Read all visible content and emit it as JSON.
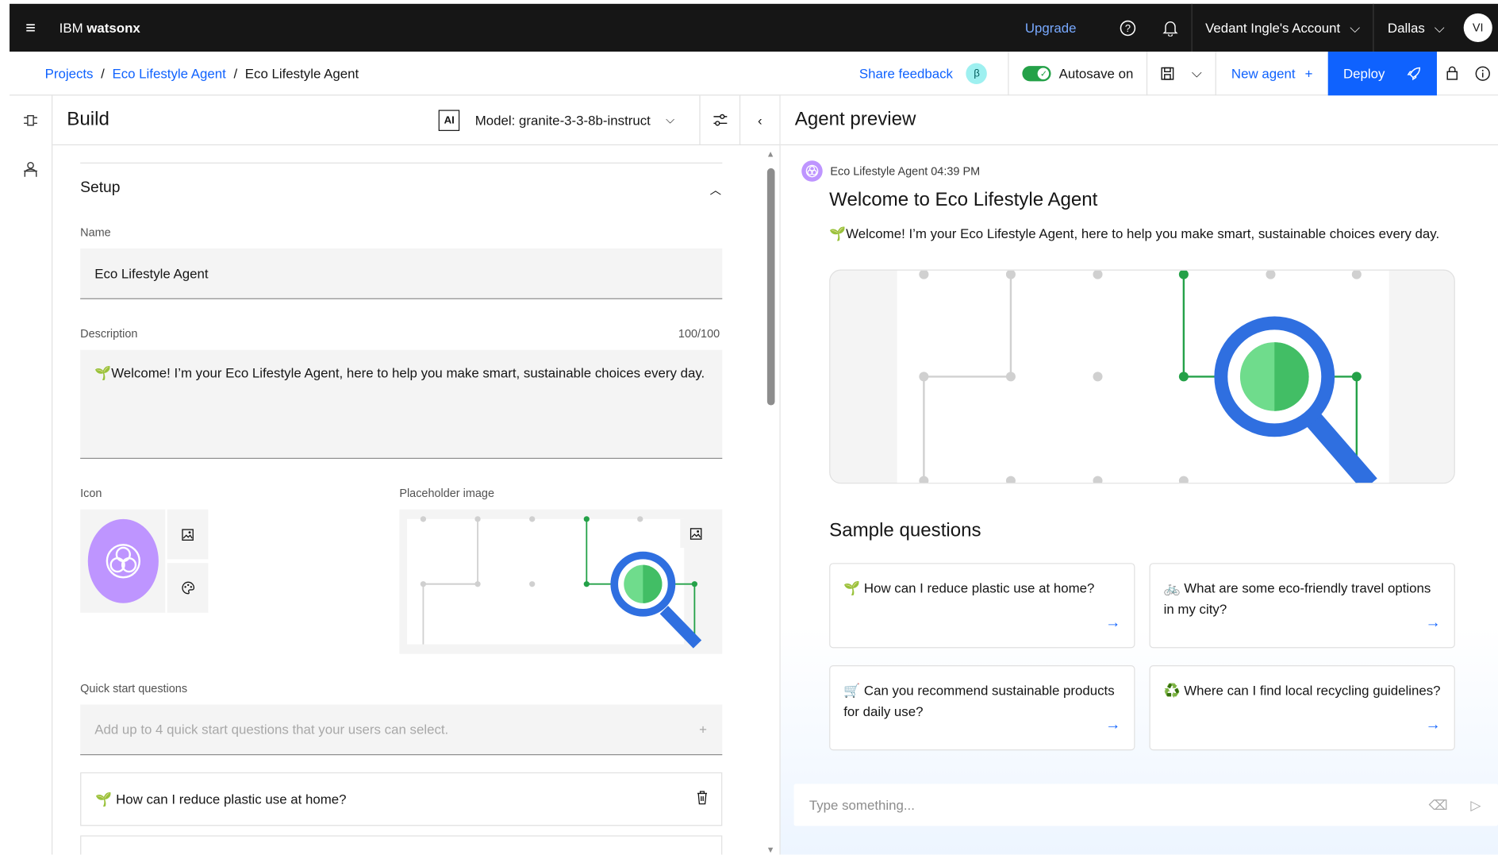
{
  "topbar": {
    "brand_prefix": "IBM",
    "brand_name": "watsonx",
    "upgrade": "Upgrade",
    "account": "Vedant Ingle's Account",
    "region": "Dallas",
    "avatar": "VI"
  },
  "subbar": {
    "breadcrumbs": [
      "Projects",
      "Eco Lifestyle Agent",
      "Eco Lifestyle Agent"
    ],
    "share_feedback": "Share feedback",
    "beta": "β",
    "autosave": "Autosave on",
    "new_agent": "New agent",
    "deploy": "Deploy"
  },
  "build": {
    "title": "Build",
    "ai_badge": "AI",
    "model": "Model: granite-3-3-8b-instruct",
    "setup": "Setup",
    "name_label": "Name",
    "name_value": "Eco Lifestyle Agent",
    "description_label": "Description",
    "description_count": "100/100",
    "description_value": "🌱Welcome! I’m your Eco Lifestyle Agent, here to help you make smart, sustainable choices every day.",
    "icon_label": "Icon",
    "placeholder_label": "Placeholder image",
    "quick_label": "Quick start questions",
    "quick_placeholder": "Add up to 4 quick start questions that your users can select.",
    "quick_items": [
      "🌱 How can I reduce plastic use at home?"
    ]
  },
  "preview": {
    "title": "Agent preview",
    "meta": "Eco Lifestyle Agent 04:39 PM",
    "welcome_title": "Welcome to Eco Lifestyle Agent",
    "welcome_text": "🌱Welcome! I’m your Eco Lifestyle Agent, here to help you make smart, sustainable choices every day.",
    "sample_title": "Sample questions",
    "questions": [
      "🌱 How can I reduce plastic use at home?",
      "🚲 What are some eco-friendly travel options in my city?",
      "🛒 Can you recommend sustainable products for daily use?",
      "♻️ Where can I find local recycling guidelines?"
    ],
    "input_placeholder": "Type something..."
  },
  "colors": {
    "accent": "#0f62fe",
    "topbar": "#161616",
    "toggle_on": "#24a148",
    "agent_icon": "#be95ff"
  }
}
